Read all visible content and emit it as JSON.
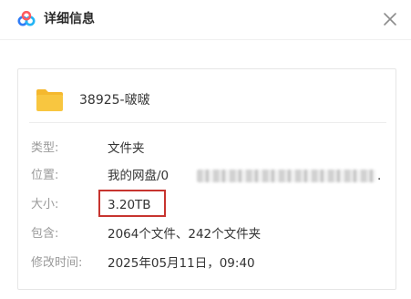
{
  "dialog": {
    "title": "详细信息",
    "close_icon": "close-icon",
    "logo_icon": "baidu-netdisk-logo-icon"
  },
  "file": {
    "icon": "folder-icon",
    "name": "38925-啵啵"
  },
  "details": {
    "type_label": "类型:",
    "type_value": "文件夹",
    "location_label": "位置:",
    "location_value_prefix": "我的网盘/0",
    "location_value_suffix": ".",
    "size_label": "大小:",
    "size_value": "3.20TB",
    "contents_label": "包含:",
    "contents_value": "2064个文件、242个文件夹",
    "modified_label": "修改时间:",
    "modified_value": "2025年05月11日，09:40"
  },
  "colors": {
    "highlight": "#c7342f",
    "folder": "#f8c640"
  }
}
